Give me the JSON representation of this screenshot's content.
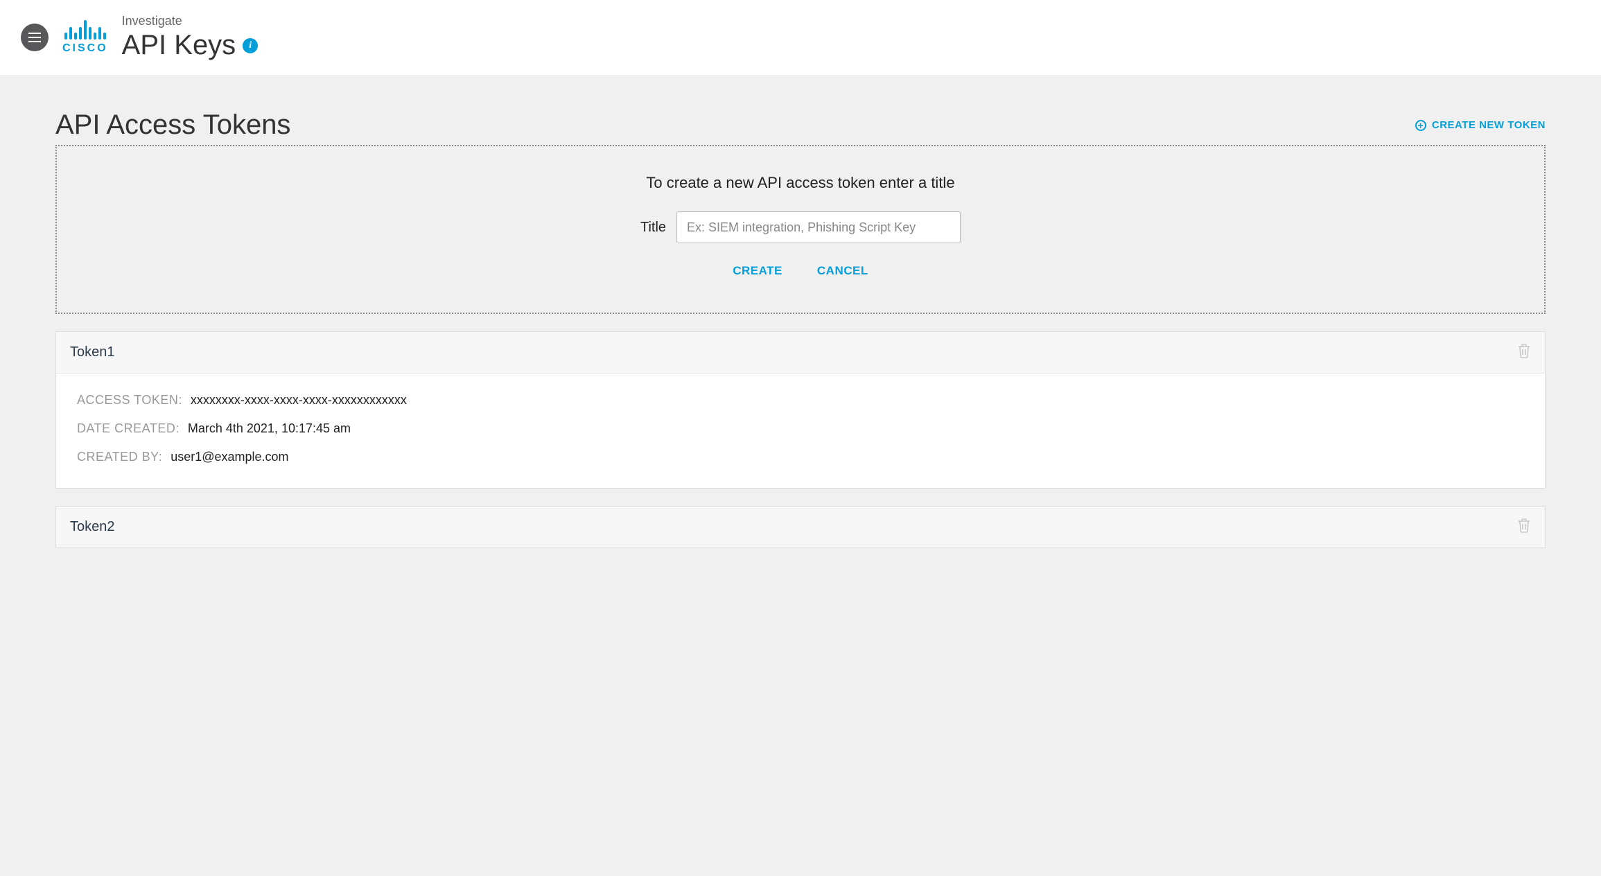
{
  "header": {
    "subtitle": "Investigate",
    "title": "API Keys",
    "logo_text": "CISCO"
  },
  "section": {
    "title": "API Access Tokens",
    "create_new_label": "CREATE NEW TOKEN"
  },
  "create_panel": {
    "instruction": "To create a new API access token enter a title",
    "title_label": "Title",
    "title_placeholder": "Ex: SIEM integration, Phishing Script Key",
    "title_value": "",
    "create_label": "CREATE",
    "cancel_label": "CANCEL"
  },
  "tokens": [
    {
      "name": "Token1",
      "fields": {
        "access_token_label": "ACCESS TOKEN:",
        "access_token_value": "xxxxxxxx-xxxx-xxxx-xxxx-xxxxxxxxxxxx",
        "date_created_label": "DATE CREATED:",
        "date_created_value": "March 4th 2021, 10:17:45 am",
        "created_by_label": "CREATED BY:",
        "created_by_value": "user1@example.com"
      }
    },
    {
      "name": "Token2"
    }
  ]
}
